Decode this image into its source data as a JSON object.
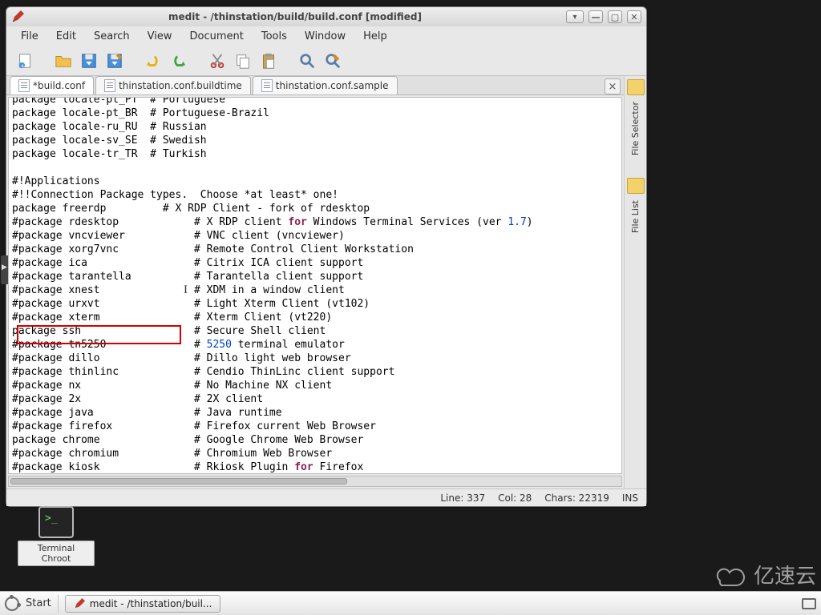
{
  "window": {
    "title": "medit - /thinstation/build/build.conf [modified]"
  },
  "menu": {
    "file": "File",
    "edit": "Edit",
    "search": "Search",
    "view": "View",
    "document": "Document",
    "tools": "Tools",
    "window": "Window",
    "help": "Help"
  },
  "tabs": {
    "t0": "*build.conf",
    "t1": "thinstation.conf.buildtime",
    "t2": "thinstation.conf.sample"
  },
  "sidebar": {
    "selector": "File Selector",
    "list": "File List"
  },
  "status": {
    "line": "Line: 337",
    "col": "Col: 28",
    "chars": "Chars: 22319",
    "mode": "INS"
  },
  "desktop": {
    "terminal": "Terminal Chroot"
  },
  "taskbar": {
    "start": "Start",
    "task0": "medit - /thinstation/buil..."
  },
  "code": {
    "lines": [
      "package locale-pt_PT  # Portuguese",
      "package locale-pt_BR  # Portuguese-Brazil",
      "package locale-ru_RU  # Russian",
      "package locale-sv_SE  # Swedish",
      "package locale-tr_TR  # Turkish",
      "",
      "#!Applications",
      "#!!Connection Package types.  Choose *at least* one!",
      "package freerdp         # X RDP Client - fork of rdesktop",
      "#package rdesktop            # X RDP client for Windows Terminal Services (ver 1.7)",
      "#package vncviewer           # VNC client (vncviewer)",
      "#package xorg7vnc            # Remote Control Client Workstation",
      "#package ica                 # Citrix ICA client support",
      "#package tarantella          # Tarantella client support",
      "#package xnest               # XDM in a window client",
      "#package urxvt               # Light Xterm Client (vt102)",
      "#package xterm               # Xterm Client (vt220)",
      "package ssh                  # Secure Shell client",
      "#package tn5250              # 5250 terminal emulator",
      "#package dillo               # Dillo light web browser",
      "#package thinlinc            # Cendio ThinLinc client support",
      "#package nx                  # No Machine NX client",
      "#package 2x                  # 2X client",
      "#package java                # Java runtime",
      "#package firefox             # Firefox current Web Browser",
      "package chrome               # Google Chrome Web Browser",
      "#package chromium            # Chromium Web Browser",
      "#package kiosk               # Rkiosk Plugin for Firefox"
    ],
    "keywords": [
      "for"
    ],
    "numerics": [
      "1.7",
      "5250"
    ]
  },
  "watermark": "亿速云"
}
